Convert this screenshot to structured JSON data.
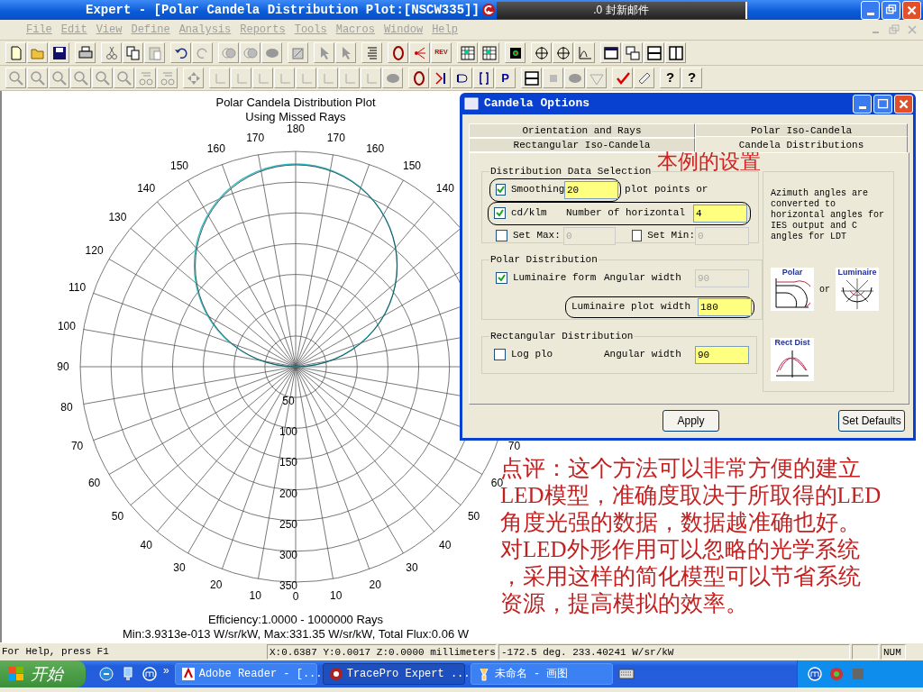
{
  "window": {
    "title": "Expert - [Polar Candela Distribution Plot:[NSCW335]]"
  },
  "mail_notice": ".0 封新邮件",
  "menu": [
    "File",
    "Edit",
    "View",
    "Define",
    "Analysis",
    "Reports",
    "Tools",
    "Macros",
    "Window",
    "Help"
  ],
  "toolbar_texts": {
    "rev": "REV",
    "p": "P",
    "help": "?",
    "context_help": "?"
  },
  "plot": {
    "title": "Polar Candela Distribution Plot",
    "subtitle": "Using Missed Rays",
    "top_label": "180",
    "left_labels": [
      "170",
      "160",
      "150",
      "140",
      "130",
      "120",
      "110",
      "100",
      "90",
      "80",
      "70",
      "60",
      "50",
      "40",
      "30",
      "20",
      "10"
    ],
    "right_upper_labels": [
      "170",
      "160",
      "150",
      "140"
    ],
    "right_lower_labels": [
      "70",
      "60",
      "50",
      "40",
      "30",
      "20",
      "10"
    ],
    "radial_labels": [
      "50",
      "100",
      "150",
      "200",
      "250",
      "300",
      "350"
    ],
    "zero_label": "0",
    "footer": [
      "Efficiency:1.0000 - 1000000 Rays",
      "Min:3.9313e-013 W/sr/kW, Max:331.35 W/sr/kW, Total Flux:0.06 W"
    ]
  },
  "dialog": {
    "title": "Candela Options",
    "tabs": [
      {
        "label": "Orientation and Rays",
        "selected": false
      },
      {
        "label": "Polar Iso-Candela",
        "selected": false
      },
      {
        "label": "Rectangular Iso-Candela",
        "selected": false
      },
      {
        "label": "Candela Distributions",
        "selected": true
      }
    ],
    "annotation": "本例的设置",
    "data_selection": {
      "title": "Distribution Data Selection",
      "smoothing": {
        "label": "Smoothing",
        "checked": true,
        "value": "20",
        "circled": true
      },
      "plot_points_text": "plot points or",
      "cdklm": {
        "label": "cd/klm",
        "checked": true,
        "circled": true
      },
      "horizontal": {
        "label": "Number of horizontal",
        "value": "4"
      },
      "set_max": {
        "label": "Set Max:",
        "checked": false,
        "value": "0",
        "disabled": true
      },
      "set_min": {
        "label": "Set Min:",
        "checked": false,
        "value": "0",
        "disabled": true
      }
    },
    "polar_distribution": {
      "title": "Polar Distribution",
      "luminaire_form": {
        "label": "Luminaire form",
        "checked": true
      },
      "angular_width": {
        "label": "Angular width",
        "value": "90",
        "disabled": true
      },
      "plot_width": {
        "label": "Luminaire plot width",
        "value": "180",
        "disabled": false,
        "circled": true
      }
    },
    "rectangular_distribution": {
      "title": "Rectangular Distribution",
      "log_plot": {
        "label": "Log plo",
        "checked": false
      },
      "angular_width": {
        "label": "Angular width",
        "value": "90",
        "disabled": false
      }
    },
    "note": "Azimuth angles are converted to horizontal angles for IES output and C angles for LDT",
    "diagrams": {
      "polar": "Polar",
      "or": "or",
      "luminaire": "Luminaire",
      "rect": "Rect Dist"
    },
    "buttons": [
      "Apply",
      "Set Defaults"
    ]
  },
  "comment": [
    "点评：这个方法可以非常方便的建立",
    "LED模型，准确度取决于所取得的LED",
    "角度光强的数据，数据越准确也好。",
    "对LED外形作用可以忽略的光学系统",
    "，采用这样的简化模型可以节省系统",
    "资源，提高模拟的效率。"
  ],
  "status_bar": {
    "help": "For Help, press F1",
    "coords": "X:0.6387 Y:0.0017 Z:0.0000 millimeters",
    "reading": "-172.5 deg. 233.40241 W/sr/kW",
    "num": "NUM"
  },
  "taskbar": {
    "start": "开始",
    "chevron": "»",
    "tasks": [
      {
        "label": "Adobe Reader - [...",
        "selected": false
      },
      {
        "label": "TracePro Expert ...",
        "selected": true
      },
      {
        "label": "未命名 - 画图",
        "selected": false
      }
    ]
  }
}
